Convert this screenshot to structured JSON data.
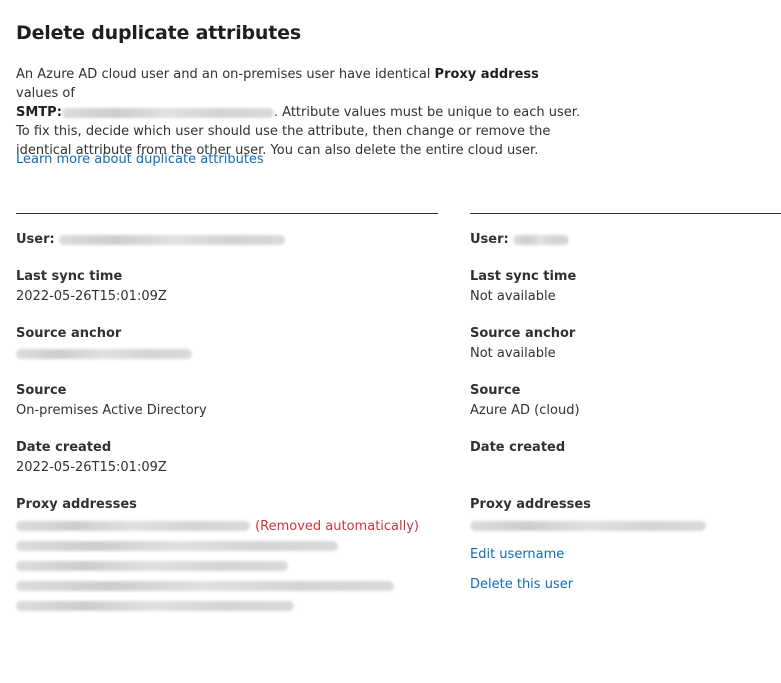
{
  "dialog": {
    "title": "Delete duplicate attributes",
    "desc_1": "An Azure AD cloud user and an on-premises user have identical",
    "desc_bold_1": "Proxy address",
    "desc_2": "values of",
    "desc_bold_2": "SMTP:",
    "desc_3": ". Attribute values must be unique to each user. To fix this, decide which user should use the attribute, then change or remove the identical attribute from the other user. You can also delete the entire cloud user.",
    "learn_more": "Learn more about duplicate attributes"
  },
  "left_user": {
    "user_label": "User:",
    "last_sync_label": "Last sync time",
    "last_sync_value": "2022-05-26T15:01:09Z",
    "source_anchor_label": "Source anchor",
    "source_label": "Source",
    "source_value": "On-premises Active Directory",
    "date_created_label": "Date created",
    "date_created_value": "2022-05-26T15:01:09Z",
    "proxy_label": "Proxy addresses",
    "removed_note": "(Removed automatically)"
  },
  "right_user": {
    "user_label": "User:",
    "last_sync_label": "Last sync time",
    "last_sync_value": "Not available",
    "source_anchor_label": "Source anchor",
    "source_anchor_value": "Not available",
    "source_label": "Source",
    "source_value": "Azure AD (cloud)",
    "date_created_label": "Date created",
    "proxy_label": "Proxy addresses",
    "edit_username": "Edit username",
    "delete_user": "Delete this user"
  },
  "colors": {
    "link": "#0f6cbd",
    "removed": "#d13438",
    "text": "#323130"
  },
  "icons": []
}
